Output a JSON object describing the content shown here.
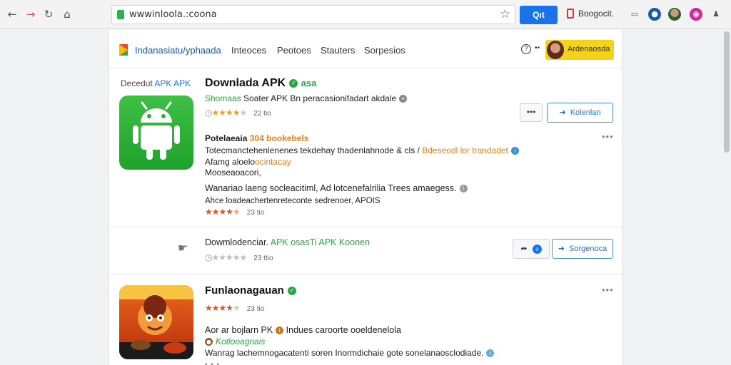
{
  "browser": {
    "url": "wwwinloola.:coona",
    "search_label": "Qıt",
    "extension_label": "Boogocit.",
    "icons": [
      "back-icon",
      "forward-icon",
      "reload-icon",
      "home-icon",
      "bookmark-star-icon"
    ]
  },
  "header": {
    "brand": "Indanasiatu/yphaada",
    "nav": [
      "Inteoces",
      "Peotoes",
      "Stauters",
      "Sorpesios"
    ],
    "user_name": "Ardenaosda",
    "accent": "#f6d31b"
  },
  "app1": {
    "section_label_prefix": "Decedut",
    "section_label_suffix": "APK APK",
    "title": "Downlada APK",
    "title_tag": "asa",
    "subtitle_green": "Shomaas",
    "subtitle_rest": "Soater APK Bn peracasionifadart akdale",
    "rating_count": "22 tio",
    "follow_label": "Kolenlan",
    "more_label": "•••",
    "desc_head_black": "Potelaeaia",
    "desc_head_orange": "304 bookebels",
    "desc_line1_black": "Totecmanctehenlenenes tekdehay thadenlahnode & cls /",
    "desc_line1_orange": "Bdeseodl lor trandadet",
    "desc_line2_black": "Afamg aloelo",
    "desc_line2_orange": "ocintacay",
    "desc_link": "Mooseaoacori,",
    "note": "Wanariao laeng socleacitiml, Ad lotcenefalrilia Trees amaegess.",
    "note_link": "Ahce loadeachertenreteconte sedrenoer, APOIS",
    "rating2_count": "23 tio"
  },
  "app2": {
    "download_text": "Dowmlodenciar.",
    "download_green": "APK osasTi APK Koonen",
    "share_label": "Sorgenoca",
    "rating_count": "23 ttio"
  },
  "app3": {
    "title": "Funlaonagauan",
    "rating_count": "23 tio",
    "line1_black": "Aor ar bojlarn PK",
    "line1_rest": "Indues caroorte ooeldenelola",
    "line2_green": "Kotlooagnais",
    "line3": "Wanrag lachemnogacatenti soren Inormdichaie gote sonelanaosclodiade."
  },
  "colors": {
    "link_blue": "#1a73e8",
    "green": "#2aa646",
    "orange": "#ef7d14",
    "star": "#e8a520"
  }
}
